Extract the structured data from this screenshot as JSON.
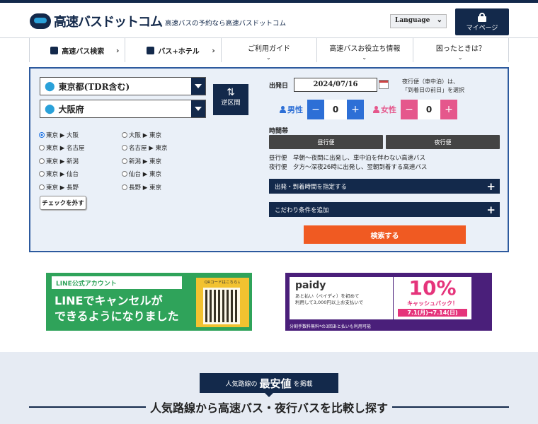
{
  "header": {
    "logo_text": "高速バスドットコム",
    "tagline": "高速バスの予約なら高速バスドットコム",
    "language_label": "Language",
    "mypage_label": "マイページ"
  },
  "nav": [
    {
      "label": "高速バス検索",
      "icon": "bus-icon"
    },
    {
      "label": "バス+ホテル",
      "icon": "bus-hotel-icon"
    },
    {
      "label": "ご利用ガイド"
    },
    {
      "label": "高速バスお役立ち情報"
    },
    {
      "label": "困ったときは？"
    }
  ],
  "search": {
    "origin": "東京都(TDR含む)",
    "destination": "大阪府",
    "swap_label": "逆区間",
    "routes_left": [
      "東京 ▶ 大阪",
      "東京 ▶ 名古屋",
      "東京 ▶ 新潟",
      "東京 ▶ 仙台",
      "東京 ▶ 長野"
    ],
    "routes_right": [
      "大阪 ▶ 東京",
      "名古屋 ▶ 東京",
      "新潟 ▶ 東京",
      "仙台 ▶ 東京",
      "長野 ▶ 東京"
    ],
    "uncheck_label": "チェックを外す",
    "date_label": "出発日",
    "date_value": "2024/07/16",
    "night_note_1": "夜行便（車中泊）は、",
    "night_note_2": "「到着日の前日」を選択",
    "male_label": "男性",
    "male_count": "0",
    "female_label": "女性",
    "female_count": "0",
    "minus": "−",
    "plus": "+",
    "time_label": "時間帯",
    "day_button": "昼行便",
    "night_button": "夜行便",
    "day_desc": "昼行便　早朝～夜間に出発し、車中泊を伴わない高速バス",
    "night_desc": "夜行便　夕方～深夜26時に出発し、翌朝到着する高速バス",
    "time_spec_label": "出発・到着時間を指定する",
    "conditions_label": "こだわり条件を追加",
    "search_button": "検索する"
  },
  "banners": {
    "line_tag": "LINE公式アカウント",
    "line_main_1": "LINEでキャンセルが",
    "line_main_2": "できるようになりました",
    "line_qr_caption": "QRコードはこちら↓",
    "paidy_logo": "paidy",
    "paidy_line1": "あと払い（ペイディ）を初めて",
    "paidy_line2": "利用して3,000円以上お支払いで",
    "paidy_percent": "10%",
    "paidy_cashback": "キャッシュバック！",
    "paidy_dates": "7.1(月)→7.14(日)",
    "paidy_footer": "分割手数料無料*の3回あと払いも利用可能"
  },
  "lower": {
    "pill_pre": "人気路線の",
    "pill_strong": "最安値",
    "pill_post": "を掲載",
    "title": "人気路線から高速バス・夜行バスを比較し探す"
  },
  "colors": {
    "navy": "#13294b",
    "orange": "#f05a22",
    "male_blue": "#2d6fd6",
    "female_pink": "#e5578c",
    "line_green": "#2fa35a"
  }
}
